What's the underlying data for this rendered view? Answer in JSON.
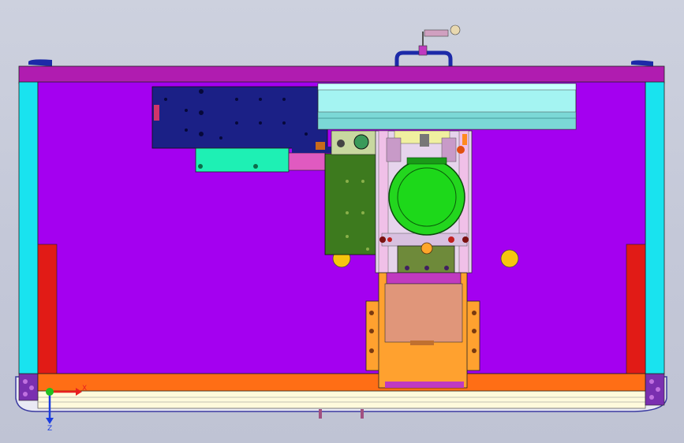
{
  "viewport": {
    "background": "#c6cada",
    "description_colors": {
      "frame_top_bar": "#b01cb0",
      "panel": "#a400f0",
      "side_rail": "#19e3ef",
      "red_block": "#e11b16",
      "bottom_rail": "#ff6e15",
      "motor": "#23d61e",
      "servo_plate": "#1b2086",
      "linear_guide": "#a4f4f2",
      "green_bracket": "#3d7a1e",
      "coupling_block": "#e0967a",
      "mount_plate": "#ffa12f",
      "yellow_dot": "#f6c50e",
      "base_plate": "#fdf7c2"
    }
  },
  "triad": {
    "x_label": "X",
    "z_label": "Z",
    "x_color": "#e82020",
    "z_color": "#1a3ce0",
    "y_color": "#20c020"
  }
}
